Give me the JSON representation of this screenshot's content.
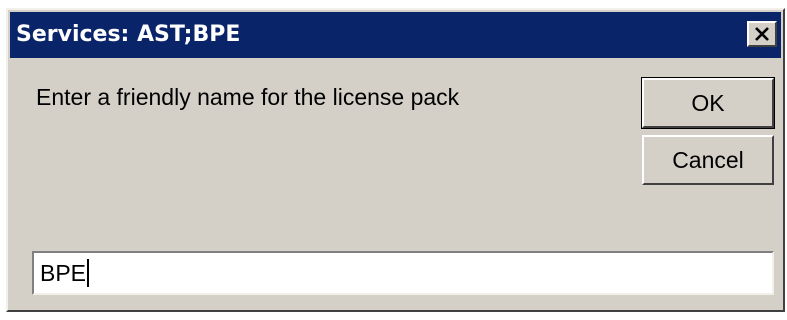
{
  "window": {
    "title": "Services: AST;BPE",
    "close_icon": "close-icon"
  },
  "prompt": {
    "label": "Enter a friendly name for the license pack"
  },
  "buttons": {
    "ok_label": "OK",
    "cancel_label": "Cancel"
  },
  "name_field": {
    "value": "BPE"
  },
  "colors": {
    "title_bar": "#0a246a",
    "dialog_face": "#d4d0c8",
    "title_text": "#ffffff"
  }
}
